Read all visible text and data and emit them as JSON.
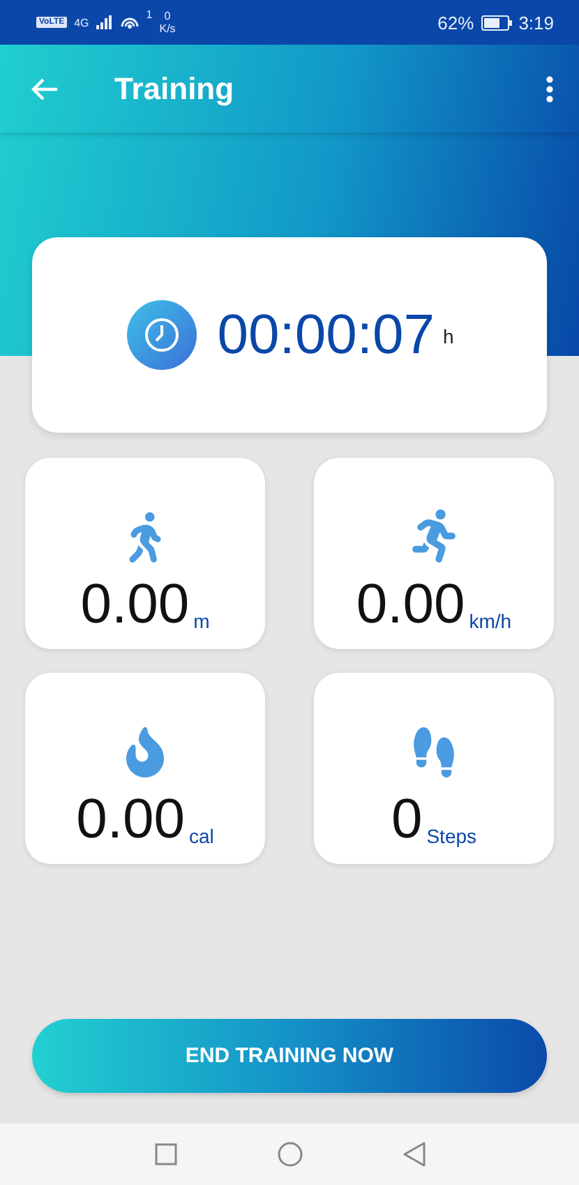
{
  "status_bar": {
    "volte": "VoLTE",
    "network": "4G",
    "hotspot_count": "1",
    "speed_value": "0",
    "speed_unit": "K/s",
    "battery": "62%",
    "time": "3:19"
  },
  "header": {
    "title": "Training"
  },
  "timer": {
    "value": "00:00:07",
    "unit": "h"
  },
  "metrics": [
    {
      "kind": "walk",
      "value": "0.00",
      "unit": "m"
    },
    {
      "kind": "run",
      "value": "0.00",
      "unit": "km/h"
    },
    {
      "kind": "fire",
      "value": "0.00",
      "unit": "cal"
    },
    {
      "kind": "steps",
      "value": "0",
      "unit": "Steps"
    }
  ],
  "end_button": {
    "label": "END TRAINING NOW"
  }
}
